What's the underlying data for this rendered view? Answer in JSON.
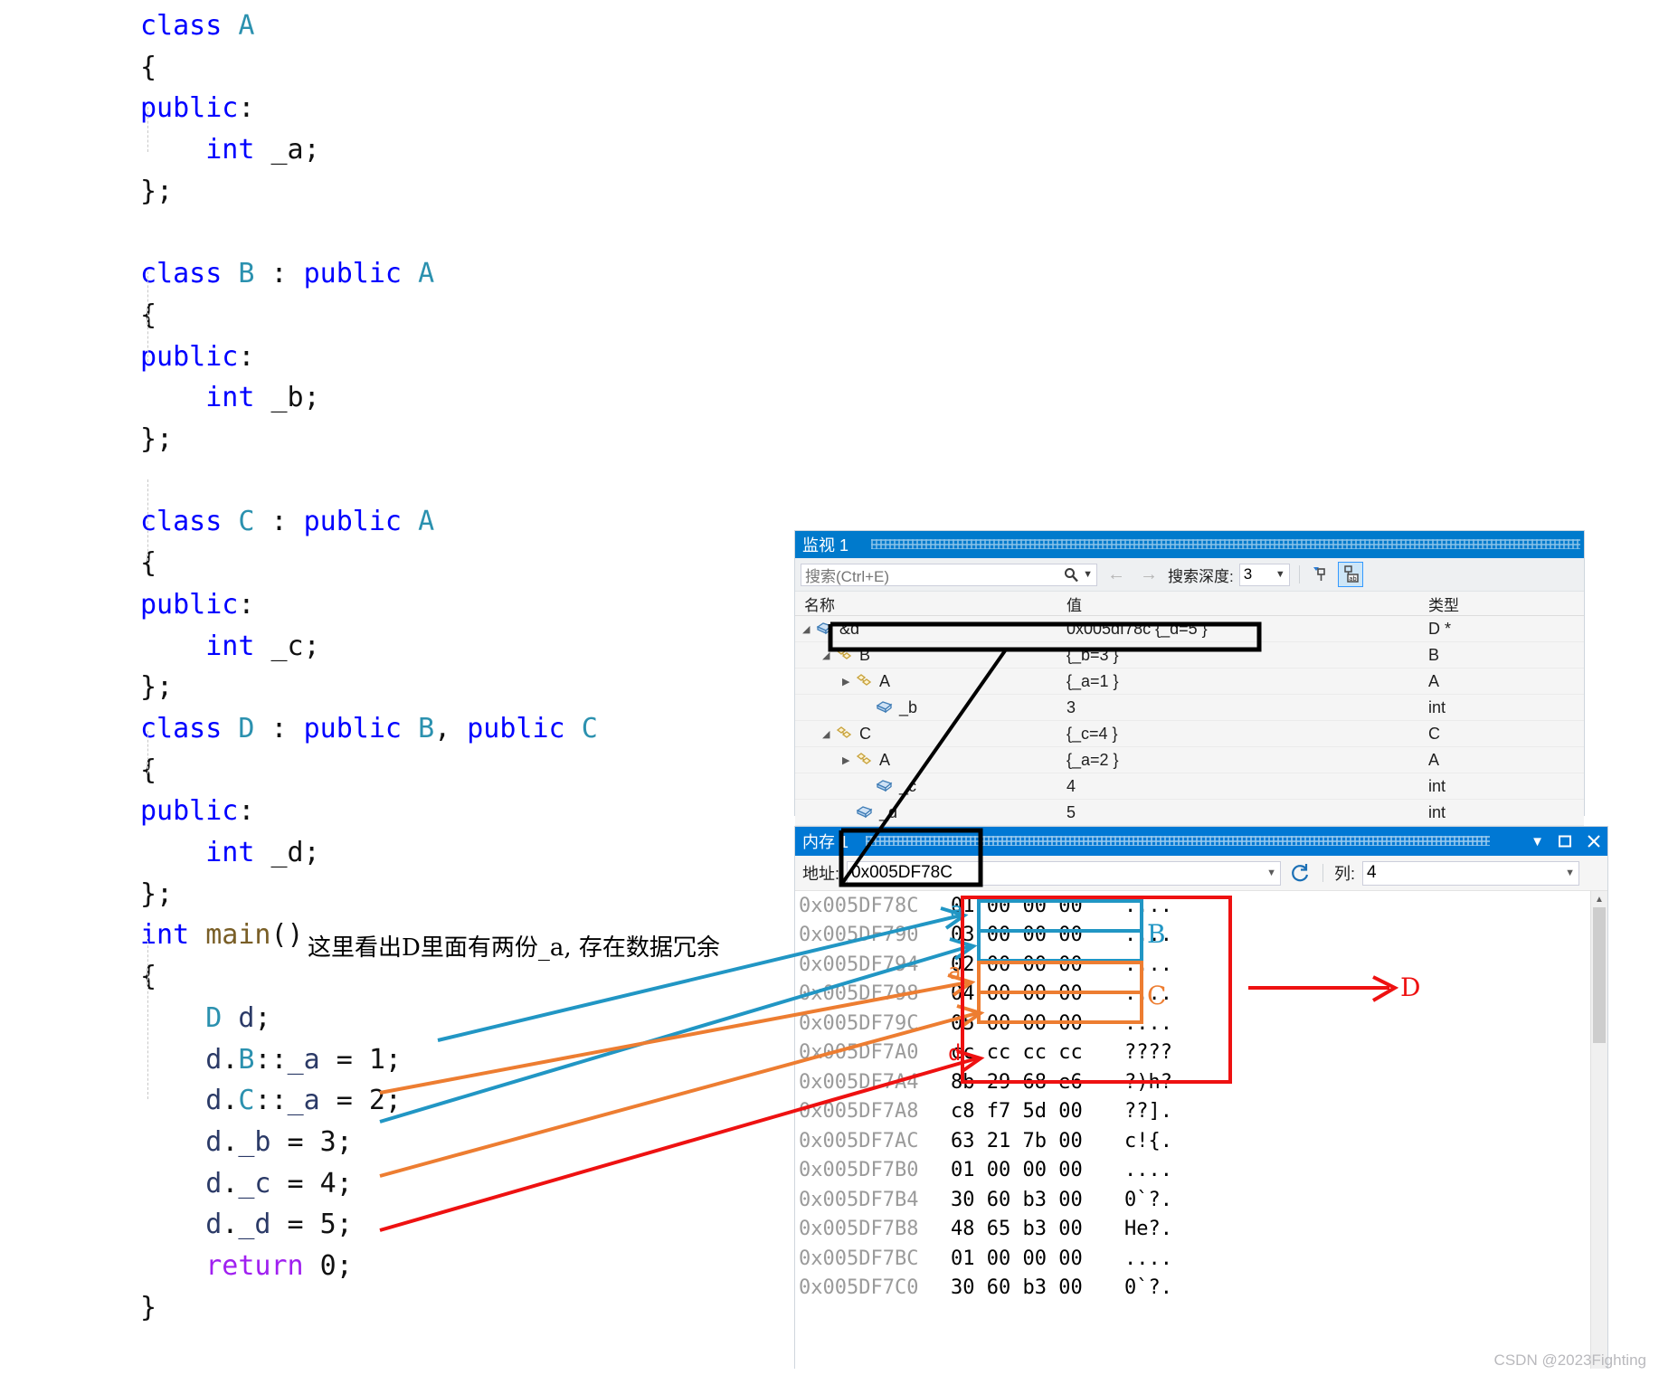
{
  "code": {
    "lines": [
      {
        "indent": 0,
        "tokens": [
          {
            "t": "class ",
            "c": "kw"
          },
          {
            "t": "A",
            "c": "typ"
          }
        ]
      },
      {
        "indent": 0,
        "tokens": [
          {
            "t": "{",
            "c": "plain"
          }
        ]
      },
      {
        "indent": 0,
        "tokens": [
          {
            "t": "public",
            "c": "kw"
          },
          {
            "t": ":",
            "c": "plain"
          }
        ]
      },
      {
        "indent": 1,
        "tokens": [
          {
            "t": "int",
            "c": "kw"
          },
          {
            "t": " _a;",
            "c": "plain"
          }
        ]
      },
      {
        "indent": 0,
        "tokens": [
          {
            "t": "};",
            "c": "plain"
          }
        ]
      },
      {
        "indent": 0,
        "tokens": []
      },
      {
        "indent": 0,
        "tokens": [
          {
            "t": "class ",
            "c": "kw"
          },
          {
            "t": "B",
            "c": "typ"
          },
          {
            "t": " : ",
            "c": "plain"
          },
          {
            "t": "public ",
            "c": "kw"
          },
          {
            "t": "A",
            "c": "typ"
          }
        ]
      },
      {
        "indent": 0,
        "tokens": [
          {
            "t": "{",
            "c": "plain"
          }
        ]
      },
      {
        "indent": 0,
        "tokens": [
          {
            "t": "public",
            "c": "kw"
          },
          {
            "t": ":",
            "c": "plain"
          }
        ]
      },
      {
        "indent": 1,
        "tokens": [
          {
            "t": "int",
            "c": "kw"
          },
          {
            "t": " _b;",
            "c": "plain"
          }
        ]
      },
      {
        "indent": 0,
        "tokens": [
          {
            "t": "};",
            "c": "plain"
          }
        ]
      },
      {
        "indent": 0,
        "tokens": []
      },
      {
        "indent": 0,
        "tokens": [
          {
            "t": "class ",
            "c": "kw"
          },
          {
            "t": "C",
            "c": "typ"
          },
          {
            "t": " : ",
            "c": "plain"
          },
          {
            "t": "public ",
            "c": "kw"
          },
          {
            "t": "A",
            "c": "typ"
          }
        ]
      },
      {
        "indent": 0,
        "tokens": [
          {
            "t": "{",
            "c": "plain"
          }
        ]
      },
      {
        "indent": 0,
        "tokens": [
          {
            "t": "public",
            "c": "kw"
          },
          {
            "t": ":",
            "c": "plain"
          }
        ]
      },
      {
        "indent": 1,
        "tokens": [
          {
            "t": "int",
            "c": "kw"
          },
          {
            "t": " _c;",
            "c": "plain"
          }
        ]
      },
      {
        "indent": 0,
        "tokens": [
          {
            "t": "};",
            "c": "plain"
          }
        ]
      },
      {
        "indent": 0,
        "tokens": [
          {
            "t": "class ",
            "c": "kw"
          },
          {
            "t": "D",
            "c": "typ"
          },
          {
            "t": " : ",
            "c": "plain"
          },
          {
            "t": "public ",
            "c": "kw"
          },
          {
            "t": "B",
            "c": "typ"
          },
          {
            "t": ", ",
            "c": "plain"
          },
          {
            "t": "public ",
            "c": "kw"
          },
          {
            "t": "C",
            "c": "typ"
          }
        ]
      },
      {
        "indent": 0,
        "tokens": [
          {
            "t": "{",
            "c": "plain"
          }
        ]
      },
      {
        "indent": 0,
        "tokens": [
          {
            "t": "public",
            "c": "kw"
          },
          {
            "t": ":",
            "c": "plain"
          }
        ]
      },
      {
        "indent": 1,
        "tokens": [
          {
            "t": "int",
            "c": "kw"
          },
          {
            "t": " _d;",
            "c": "plain"
          }
        ]
      },
      {
        "indent": 0,
        "tokens": [
          {
            "t": "};",
            "c": "plain"
          }
        ]
      },
      {
        "indent": 0,
        "tokens": [
          {
            "t": "int ",
            "c": "kw"
          },
          {
            "t": "main",
            "c": "fn"
          },
          {
            "t": "()",
            "c": "plain"
          }
        ]
      },
      {
        "indent": 0,
        "tokens": [
          {
            "t": "{",
            "c": "plain"
          }
        ]
      },
      {
        "indent": 1,
        "tokens": [
          {
            "t": "D",
            "c": "typ"
          },
          {
            "t": " ",
            "c": "plain"
          },
          {
            "t": "d",
            "c": "obj"
          },
          {
            "t": ";",
            "c": "plain"
          }
        ]
      },
      {
        "indent": 1,
        "tokens": [
          {
            "t": "d",
            "c": "obj"
          },
          {
            "t": ".",
            "c": "plain"
          },
          {
            "t": "B",
            "c": "typ"
          },
          {
            "t": "::",
            "c": "plain"
          },
          {
            "t": "_a",
            "c": "obj"
          },
          {
            "t": " = 1;",
            "c": "plain"
          }
        ]
      },
      {
        "indent": 1,
        "tokens": [
          {
            "t": "d",
            "c": "obj"
          },
          {
            "t": ".",
            "c": "plain"
          },
          {
            "t": "C",
            "c": "typ"
          },
          {
            "t": "::",
            "c": "plain"
          },
          {
            "t": "_a",
            "c": "obj"
          },
          {
            "t": " = 2;",
            "c": "plain"
          }
        ]
      },
      {
        "indent": 1,
        "tokens": [
          {
            "t": "d",
            "c": "obj"
          },
          {
            "t": ".",
            "c": "plain"
          },
          {
            "t": "_b",
            "c": "obj"
          },
          {
            "t": " = 3;",
            "c": "plain"
          }
        ]
      },
      {
        "indent": 1,
        "tokens": [
          {
            "t": "d",
            "c": "obj"
          },
          {
            "t": ".",
            "c": "plain"
          },
          {
            "t": "_c",
            "c": "obj"
          },
          {
            "t": " = 4;",
            "c": "plain"
          }
        ]
      },
      {
        "indent": 1,
        "tokens": [
          {
            "t": "d",
            "c": "obj"
          },
          {
            "t": ".",
            "c": "plain"
          },
          {
            "t": "_d",
            "c": "obj"
          },
          {
            "t": " = 5;",
            "c": "plain"
          }
        ]
      },
      {
        "indent": 1,
        "tokens": [
          {
            "t": "return",
            "c": "ret"
          },
          {
            "t": " 0;",
            "c": "plain"
          }
        ]
      },
      {
        "indent": 0,
        "tokens": [
          {
            "t": "}",
            "c": "plain"
          }
        ]
      }
    ],
    "annotation_note": "这里看出D里面有两份_a, 存在数据冗余"
  },
  "watch": {
    "title": "监视 1",
    "search_placeholder": "搜索(Ctrl+E)",
    "search_value": "",
    "depth_label": "搜索深度:",
    "depth_value": "3",
    "back_arrow": "←",
    "forward_arrow": "→",
    "pin_icon": "pin-filter-icon",
    "hex_icon": "hex-display-icon",
    "columns": [
      "名称",
      "值",
      "类型"
    ],
    "rows": [
      {
        "indent": 0,
        "expander": "▲",
        "icon": "field-icon",
        "name": "&d",
        "value": "0x005df78c {_d=5 }",
        "type": "D *",
        "highlight": true
      },
      {
        "indent": 1,
        "expander": "▲",
        "icon": "class-icon",
        "name": "B",
        "value": "{_b=3 }",
        "type": "B"
      },
      {
        "indent": 2,
        "expander": "▶",
        "icon": "class-icon",
        "name": "A",
        "value": "{_a=1 }",
        "type": "A"
      },
      {
        "indent": 3,
        "expander": "",
        "icon": "field-icon",
        "name": "_b",
        "value": "3",
        "type": "int"
      },
      {
        "indent": 1,
        "expander": "▲",
        "icon": "class-icon",
        "name": "C",
        "value": "{_c=4 }",
        "type": "C"
      },
      {
        "indent": 2,
        "expander": "▶",
        "icon": "class-icon",
        "name": "A",
        "value": "{_a=2 }",
        "type": "A"
      },
      {
        "indent": 3,
        "expander": "",
        "icon": "field-icon",
        "name": "_c",
        "value": "4",
        "type": "int"
      },
      {
        "indent": 2,
        "expander": "",
        "icon": "field-icon",
        "name": "_d",
        "value": "5",
        "type": "int"
      }
    ]
  },
  "memory": {
    "title": "内存 1",
    "address_label": "地址:",
    "address_value": "0x005DF78C",
    "refresh_icon": "refresh-icon",
    "columns_label": "列:",
    "columns_value": "4",
    "dropdown_icon": "chevron-down-icon",
    "maximize_icon": "maximize-icon",
    "close_icon": "close-icon",
    "rows": [
      {
        "addr": "0x005DF78C",
        "hex": "01 00 00 00",
        "ascii": "...."
      },
      {
        "addr": "0x005DF790",
        "hex": "03 00 00 00",
        "ascii": "...."
      },
      {
        "addr": "0x005DF794",
        "hex": "02 00 00 00",
        "ascii": "...."
      },
      {
        "addr": "0x005DF798",
        "hex": "04 00 00 00",
        "ascii": "...."
      },
      {
        "addr": "0x005DF79C",
        "hex": "05 00 00 00",
        "ascii": "...."
      },
      {
        "addr": "0x005DF7A0",
        "hex": "cc cc cc cc",
        "ascii": "????"
      },
      {
        "addr": "0x005DF7A4",
        "hex": "8b 29 68 e6",
        "ascii": "?)h?"
      },
      {
        "addr": "0x005DF7A8",
        "hex": "c8 f7 5d 00",
        "ascii": "??]."
      },
      {
        "addr": "0x005DF7AC",
        "hex": "63 21 7b 00",
        "ascii": "c!{."
      },
      {
        "addr": "0x005DF7B0",
        "hex": "01 00 00 00",
        "ascii": "...."
      },
      {
        "addr": "0x005DF7B4",
        "hex": "30 60 b3 00",
        "ascii": "0`?."
      },
      {
        "addr": "0x005DF7B8",
        "hex": "48 65 b3 00",
        "ascii": "He?."
      },
      {
        "addr": "0x005DF7BC",
        "hex": "01 00 00 00",
        "ascii": "...."
      },
      {
        "addr": "0x005DF7C0",
        "hex": "30 60 b3 00",
        "ascii": "0`?."
      }
    ]
  },
  "annotations": {
    "label_b": "B",
    "label_c": "C",
    "label_d": "D",
    "mem_a1": "a",
    "mem_a2": "a",
    "mem_d": "d",
    "colors": {
      "blue": "#2196c4",
      "orange": "#ed7d31",
      "red": "#ee1111",
      "black": "#000000"
    }
  },
  "watermark": "CSDN @2023Fighting"
}
